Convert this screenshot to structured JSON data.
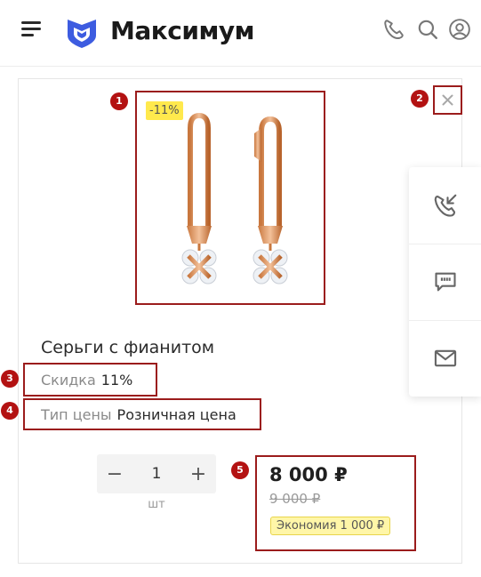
{
  "header": {
    "brand": "Максимум",
    "icons": [
      "menu-icon",
      "logo-icon",
      "phone-icon",
      "search-icon",
      "user-icon"
    ],
    "brand_color": "#3d5ce0"
  },
  "product": {
    "badge": "-11%",
    "title": "Серьги с фианитом",
    "discount_label": "Скидка",
    "discount_value": "11%",
    "price_type_label": "Тип цены",
    "price_type_value": "Розничная цена",
    "quantity": "1",
    "unit": "шт",
    "qty_minus": "−",
    "qty_plus": "+",
    "price_current": "8 000 ₽",
    "price_old": "9 000 ₽",
    "economy": "Экономия 1 000 ₽"
  },
  "close_label": "×",
  "side_actions": [
    "callback-icon",
    "chat-icon",
    "mail-icon"
  ],
  "markers": [
    "1",
    "2",
    "3",
    "4",
    "5"
  ],
  "colors": {
    "accent_badge": "#ffe94d",
    "marker": "#b31212",
    "highlight_border": "#9b1c1c"
  }
}
